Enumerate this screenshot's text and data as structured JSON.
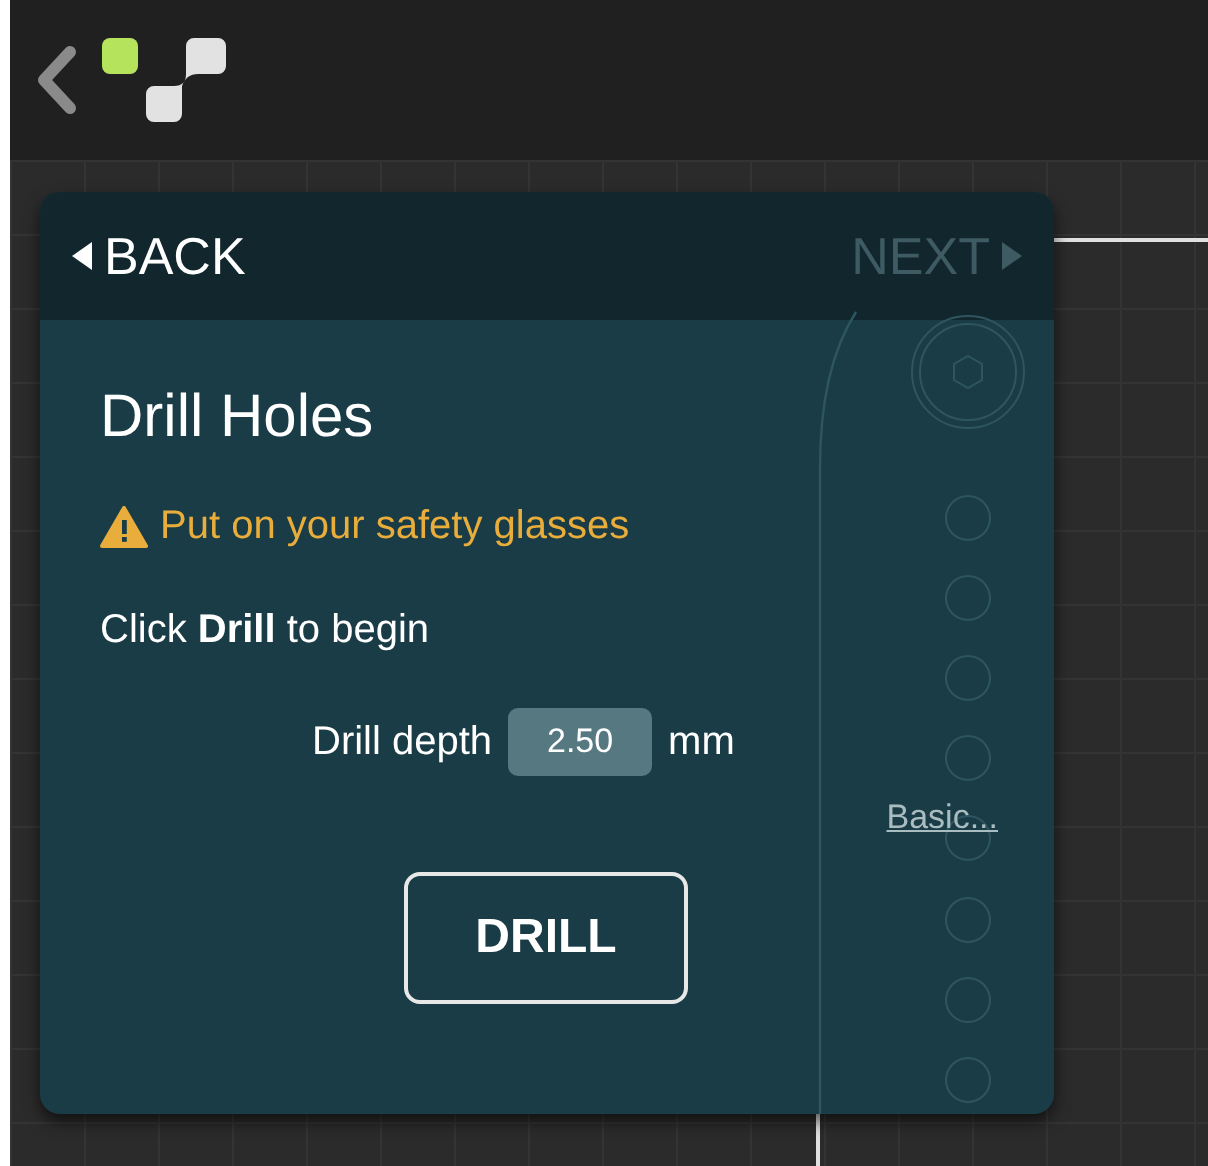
{
  "nav": {
    "back": {
      "label": "BACK",
      "disabled": false
    },
    "next": {
      "label": "NEXT",
      "disabled": true
    }
  },
  "step": {
    "title": "Drill Holes",
    "warning": "Put on your safety glasses",
    "instruction": "Click **Drill** to begin",
    "depth_label": "Drill depth",
    "depth_value": "2.50",
    "depth_unit": "mm",
    "mode_link": "Basic...",
    "action": "DRILL"
  }
}
